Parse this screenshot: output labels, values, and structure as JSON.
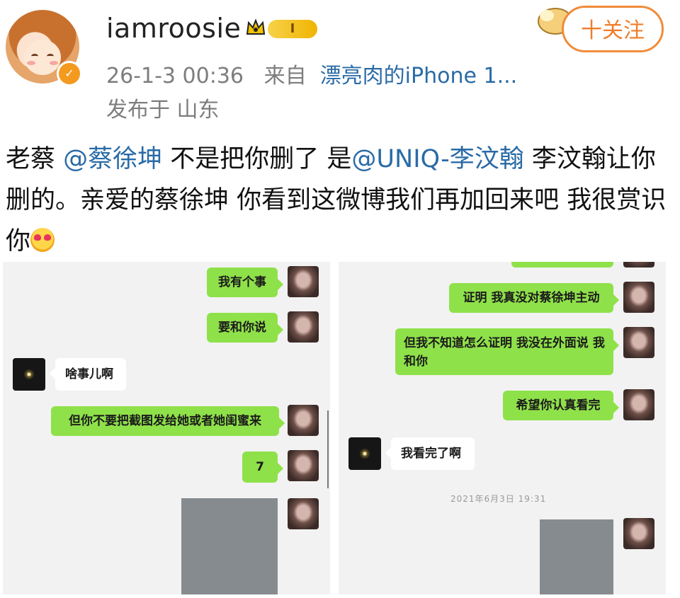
{
  "header": {
    "username": "iamroosie",
    "level": "I",
    "timestamp": "26-1-3 00:36",
    "from_label": "来自",
    "source": "漂亮肉的iPhone 1...",
    "location": "发布于 山东",
    "follow_label": "十关注"
  },
  "post": {
    "p1": "老蔡 ",
    "m1": "@蔡徐坤",
    "p2": " 不是把你删了 是",
    "m2": "@UNIQ-李汶翰",
    "p3": " 李汶翰让你删的。亲爱的蔡徐坤 你看到这微博我们再加回来吧 我很赏识你"
  },
  "chat_left": {
    "msg1": "我有个事",
    "msg2": "要和你说",
    "msg3": "啥事儿啊",
    "msg4": "但你不要把截图发给她或者她闺蜜来",
    "msg5": "7"
  },
  "chat_right": {
    "msg1": "证明 我真没对蔡徐坤主动",
    "msg2": "但我不知道怎么证明 我没在外面说 我和你",
    "msg3": "希望你认真看完",
    "msg4": "我看完了啊",
    "timestamp": "2021年6月3日 19:31"
  },
  "colors": {
    "link": "#2a6ba6",
    "follow": "#f07d2a",
    "bubble_green": "#8fe14a",
    "verified": "#f39a1f"
  },
  "icons": [
    "crown-icon",
    "verified-icon",
    "heart-eyes-emoji"
  ]
}
